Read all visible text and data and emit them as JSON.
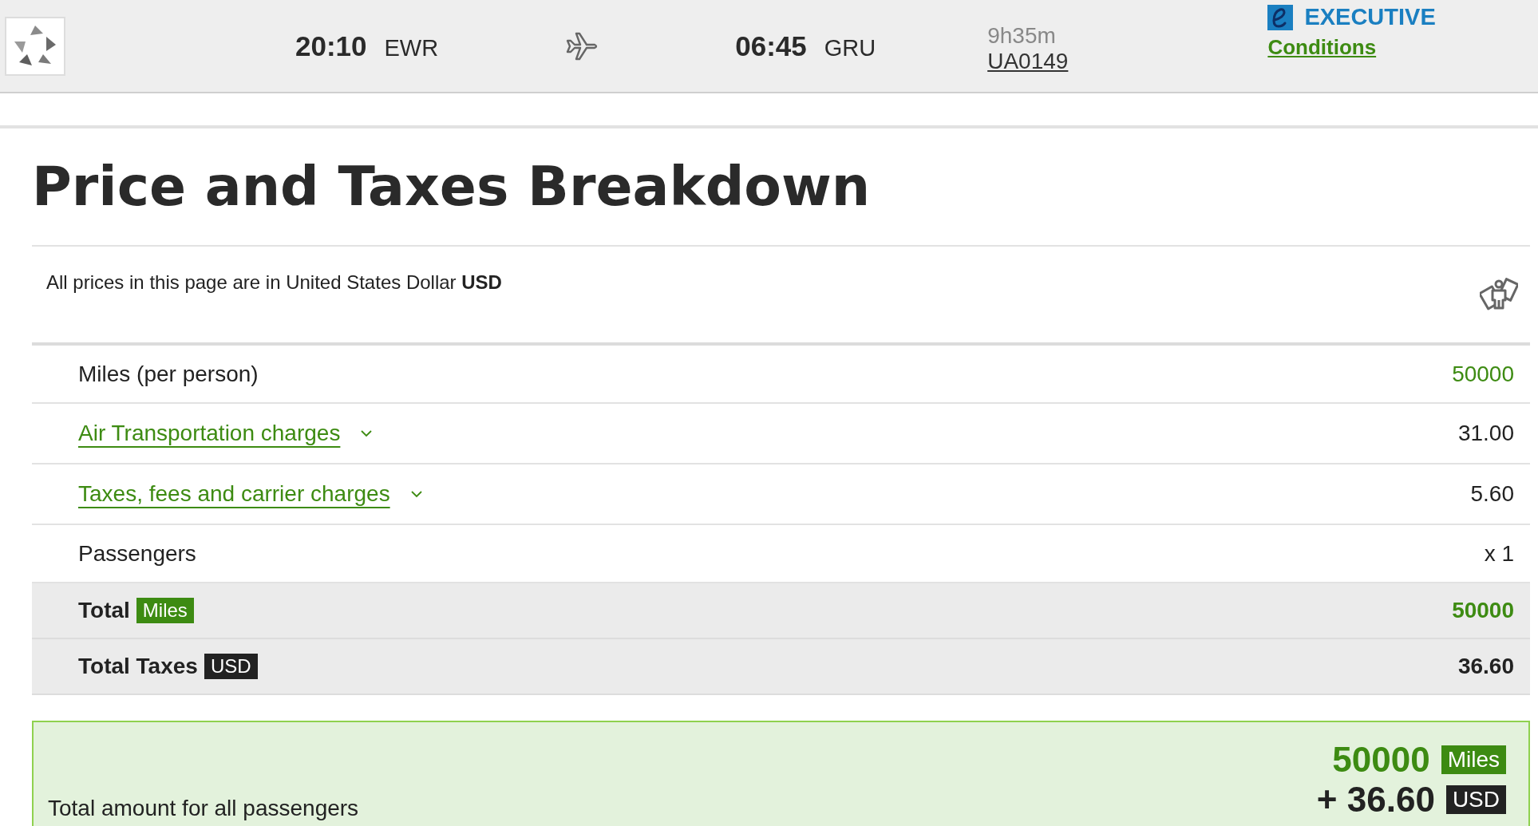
{
  "header": {
    "departure_time": "20:10",
    "departure_airport": "EWR",
    "arrival_time": "06:45",
    "arrival_airport": "GRU",
    "duration": "9h35m",
    "flight_number": "UA0149",
    "cabin": "EXECUTIVE",
    "conditions_link": "Conditions"
  },
  "title": "Price and Taxes Breakdown",
  "currency_note": "All prices in this page are in United States Dollar **USD**",
  "rows": [
    {
      "kind": "miles",
      "label": "Miles (per person)",
      "value": "50000"
    },
    {
      "kind": "expandable",
      "label": "Air Transportation charges",
      "value": "31.00",
      "expanded": false
    },
    {
      "kind": "expandable",
      "label": "Taxes, fees and carrier charges",
      "value": "5.60",
      "expanded": false
    },
    {
      "kind": "plain",
      "label": "Passengers",
      "value": "x 1"
    }
  ],
  "totals": [
    {
      "kind": "miles",
      "label": "Total",
      "badge": "Miles",
      "value": "50000"
    },
    {
      "kind": "currency",
      "label": "Total Taxes",
      "badge": "USD",
      "value": "36.60"
    }
  ],
  "grand_total": {
    "label": "Total amount for all passengers",
    "miles": "50000",
    "miles_badge": "Miles",
    "taxes": "+ 36.60",
    "taxes_badge": "USD"
  }
}
